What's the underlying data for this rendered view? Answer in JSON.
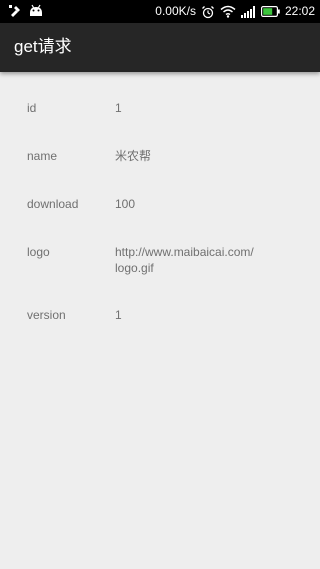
{
  "status_bar": {
    "left_icons": [
      "usb-debug-icon",
      "android-icon"
    ],
    "net_speed": "0.00K/s",
    "right_icons": [
      "alarm-icon",
      "wifi-icon",
      "signal-icon",
      "battery-icon"
    ],
    "time": "22:02"
  },
  "app_bar": {
    "title": "get请求"
  },
  "fields": [
    {
      "label": "id",
      "value": "1"
    },
    {
      "label": "name",
      "value": "米农帮"
    },
    {
      "label": "download",
      "value": "100"
    },
    {
      "label": "logo",
      "value": "http://www.maibaicai.com/\nlogo.gif"
    },
    {
      "label": "version",
      "value": "1"
    }
  ],
  "colors": {
    "background": "#eeeeee",
    "app_bar": "#262626",
    "status_bar": "#000000",
    "text": "#707070"
  }
}
